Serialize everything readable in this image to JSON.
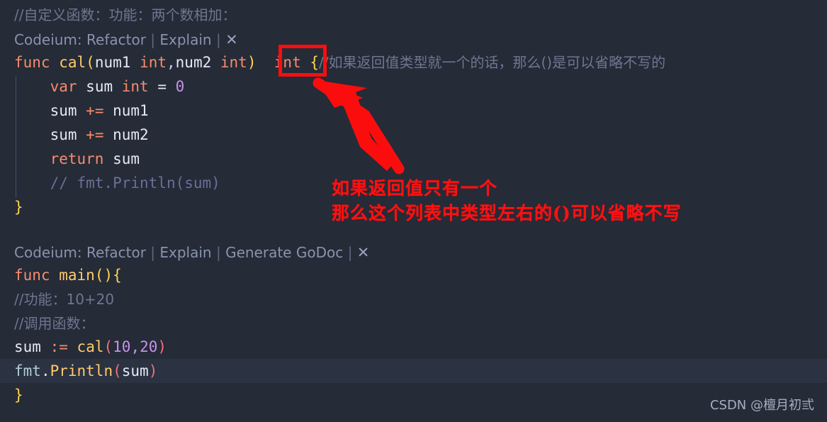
{
  "editor": {
    "background_color": "#252b37",
    "current_line_color": "#2b3242",
    "indent_guide_color": "#49506a",
    "lines": {
      "l1_comment": "//自定义函数：功能：两个数相加：",
      "l3_func": "func",
      "l3_name": "cal",
      "l3_open": "(",
      "l3_p1": "num1",
      "l3_t1": "int",
      "l3_comma": ",",
      "l3_p2": "num2",
      "l3_t2": "int",
      "l3_close": ")",
      "l3_ret": "int",
      "l3_brace": "{",
      "l3_tail_comment": "//如果返回值类型就一个的话，那么()是可以省略不写的",
      "l4_var": "var",
      "l4_name": "sum",
      "l4_type": "int",
      "l4_eq": "=",
      "l4_val": "0",
      "l5_name": "sum",
      "l5_op": "+=",
      "l5_arg": "num1",
      "l6_name": "sum",
      "l6_op": "+=",
      "l6_arg": "num2",
      "l7_return": "return",
      "l7_val": "sum",
      "l8_comment": "// fmt.Println(sum)",
      "l9_brace": "}",
      "l11_func": "func",
      "l11_name": "main",
      "l11_parens": "()",
      "l11_brace": "{",
      "l12_comment": "//功能：10+20",
      "l13_comment": "//调用函数：",
      "l14_name": "sum",
      "l14_op": ":=",
      "l14_call": "cal",
      "l14_open": "(",
      "l14_a1": "10",
      "l14_comma": ",",
      "l14_a2": "20",
      "l14_close": ")",
      "l15_pkg": "fmt",
      "l15_dot": ".",
      "l15_fn": "Println",
      "l15_open": "(",
      "l15_arg": "sum",
      "l15_close": ")",
      "l16_brace": "}"
    }
  },
  "codelens_1": {
    "prefix": "Codeium:",
    "action_refactor": "Refactor",
    "sep_1": "|",
    "action_explain": "Explain",
    "sep_2": "|",
    "close_label": "✕"
  },
  "codelens_2": {
    "prefix": "Codeium:",
    "action_refactor": "Refactor",
    "sep_1": "|",
    "action_explain": "Explain",
    "sep_2": "|",
    "action_godoc": "Generate GoDoc",
    "sep_3": "|",
    "close_label": "✕"
  },
  "annotation": {
    "color": "#ff1111",
    "box_target_text": "int",
    "line1": "如果返回值只有一个",
    "line2": "那么这个列表中类型左右的()可以省略不写"
  },
  "watermark": {
    "text": "CSDN @檀月初弎"
  }
}
